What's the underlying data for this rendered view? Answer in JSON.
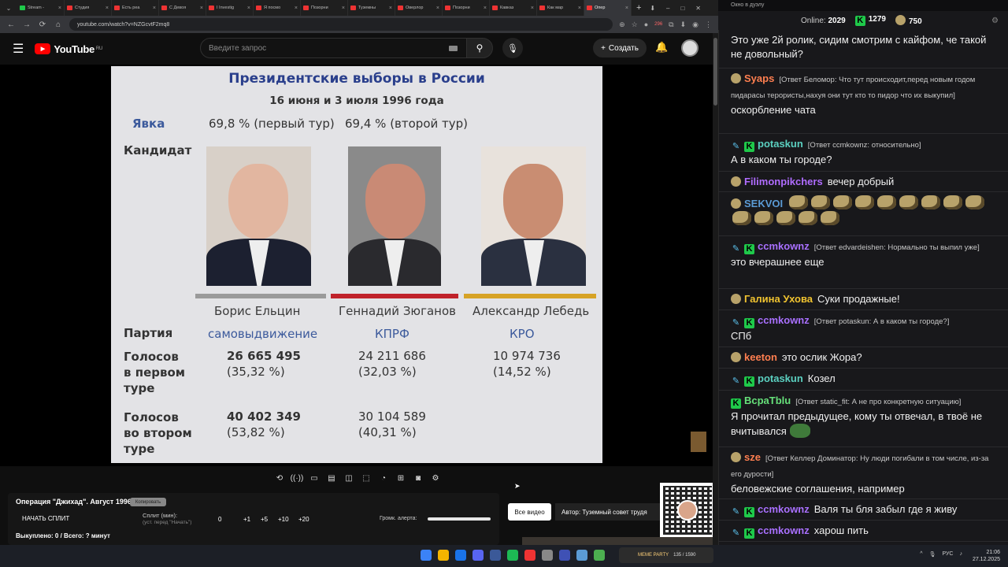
{
  "browser": {
    "tabs": [
      {
        "label": "Stream -",
        "color": "#1fc94a"
      },
      {
        "label": "Студия",
        "color": "#e33"
      },
      {
        "label": "Есть реа",
        "color": "#e33"
      },
      {
        "label": "С Девоя",
        "color": "#e33"
      },
      {
        "label": "I Investig",
        "color": "#e33"
      },
      {
        "label": "Я посмо",
        "color": "#e33"
      },
      {
        "label": "Позорни",
        "color": "#e33"
      },
      {
        "label": "Туземны",
        "color": "#e33"
      },
      {
        "label": "Оверлор",
        "color": "#e33"
      },
      {
        "label": "Позорни",
        "color": "#e33"
      },
      {
        "label": "Кавказ",
        "color": "#e33"
      },
      {
        "label": "Как мар",
        "color": "#e33"
      },
      {
        "label": "Опер",
        "color": "#e33",
        "active": true
      }
    ],
    "url": "youtube.com/watch?v=NZGcvtF2mq8",
    "badge_count": "296"
  },
  "youtube": {
    "logo": "YouTube",
    "logo_region": "RU",
    "search_placeholder": "Введите запрос",
    "create_label": "Создать"
  },
  "slide": {
    "title": "Президентские выборы в России",
    "dates": "16 июня и 3 июля 1996 года",
    "turnout_label": "Явка",
    "turnout_first": "69,8 % (первый тур)",
    "turnout_second": "69,4 % (второй тур)",
    "candidate_label": "Кандидат",
    "party_label": "Партия",
    "votes1_label": [
      "Голосов",
      "в первом",
      "туре"
    ],
    "votes2_label": [
      "Голосов",
      "во втором",
      "туре"
    ],
    "candidates": [
      {
        "name": "Борис Ельцин",
        "party": "самовыдвижение",
        "v1": "26 665 495",
        "p1": "(35,32 %)",
        "v2": "40 402 349",
        "p2": "(53,82 %)",
        "bar": "#9a9a9a"
      },
      {
        "name": "Геннадий Зюганов",
        "party": "КПРФ",
        "v1": "24 211 686",
        "p1": "(32,03 %)",
        "v2": "30 104 589",
        "p2": "(40,31 %)",
        "bar": "#c0222a"
      },
      {
        "name": "Александр Лебедь",
        "party": "КРО",
        "v1": "10 974 736",
        "p1": "(14,52 %)",
        "v2": "",
        "p2": "",
        "bar": "#d7a326"
      }
    ]
  },
  "panel": {
    "op_title": "Операция \"Джихад\". Август 1996.",
    "copy_label": "Копировать",
    "start_split": "НАЧАТЬ СПЛИТ",
    "split_label": "Сплит (мин):",
    "split_sub": "(уст. перед \"Начать\")",
    "split_values": [
      "0",
      "+1",
      "+5",
      "+10",
      "+20"
    ],
    "volume_label": "Громк. алерта:",
    "bought": "Выкуплено: 0 / Всего: ? минут",
    "all_video": "Все видео",
    "author": "Автор: Туземный совет трудя"
  },
  "chat": {
    "header": "Окно в дуэлу",
    "online_label": "Online:",
    "online": "2029",
    "k_count": "1279",
    "pug_count": "750",
    "messages": [
      {
        "text": "Это уже 2й ролик, сидим смотрим с кайфом, че такой не довольный?"
      },
      {
        "user": "Syaps",
        "color": "#ff7f50",
        "reply": "[Ответ Беломор: Что тут происходит,перед новым годом пидарасы терористы,нахуя они тут кто то пидор что их выкупил]",
        "text": "оскорбление чата"
      },
      {
        "user": "potaskun",
        "color": "#5bd0c0",
        "reply": "[Ответ ccmkownz: относительно]",
        "text": "А в каком ты городе?"
      },
      {
        "user": "Filimonpikchers",
        "color": "#b06cff",
        "text": "вечер добрый"
      },
      {
        "user": "SEKVOI",
        "color": "#5b9bd5",
        "text": ""
      },
      {
        "user": "ccmkownz",
        "color": "#a970ff",
        "reply": "[Ответ edvardeishen: Нормально ты выпил уже]",
        "text": "это вчерашнее еще"
      },
      {
        "user": "Галина Ухова",
        "color": "#f0c330",
        "text": "Суки продажные!"
      },
      {
        "user": "ccmkownz",
        "color": "#a970ff",
        "reply": "[Ответ potaskun: А в каком ты городе?]",
        "text": "СПб"
      },
      {
        "user": "keeton",
        "color": "#ff7f50",
        "text": "это ослик Жора?"
      },
      {
        "user": "potaskun",
        "color": "#5bd0c0",
        "text": "Козел"
      },
      {
        "user": "BcpaTblu",
        "color": "#66e07a",
        "reply": "[Ответ static_fit: А не про конкретную ситуацию]",
        "text": "Я прочитал предыдущее, кому ты отвечал, в твоё не вчитывался"
      },
      {
        "user": "sze",
        "color": "#ff7f50",
        "reply": "[Ответ Келлер Доминатор: Ну люди погибали в том числе, из-за его дурости]",
        "text": "беловежские соглашения, например"
      },
      {
        "user": "ccmkownz",
        "color": "#a970ff",
        "text": "Валя ты бля забыл где я живу"
      },
      {
        "user": "ccmkownz",
        "color": "#a970ff",
        "text": "харош пить"
      }
    ]
  },
  "taskbar": {
    "meme_label": "MEME PARTY",
    "meme_count": "135 / 1590",
    "lang": "РУС",
    "time": "21:06",
    "date": "27.12.2025"
  }
}
